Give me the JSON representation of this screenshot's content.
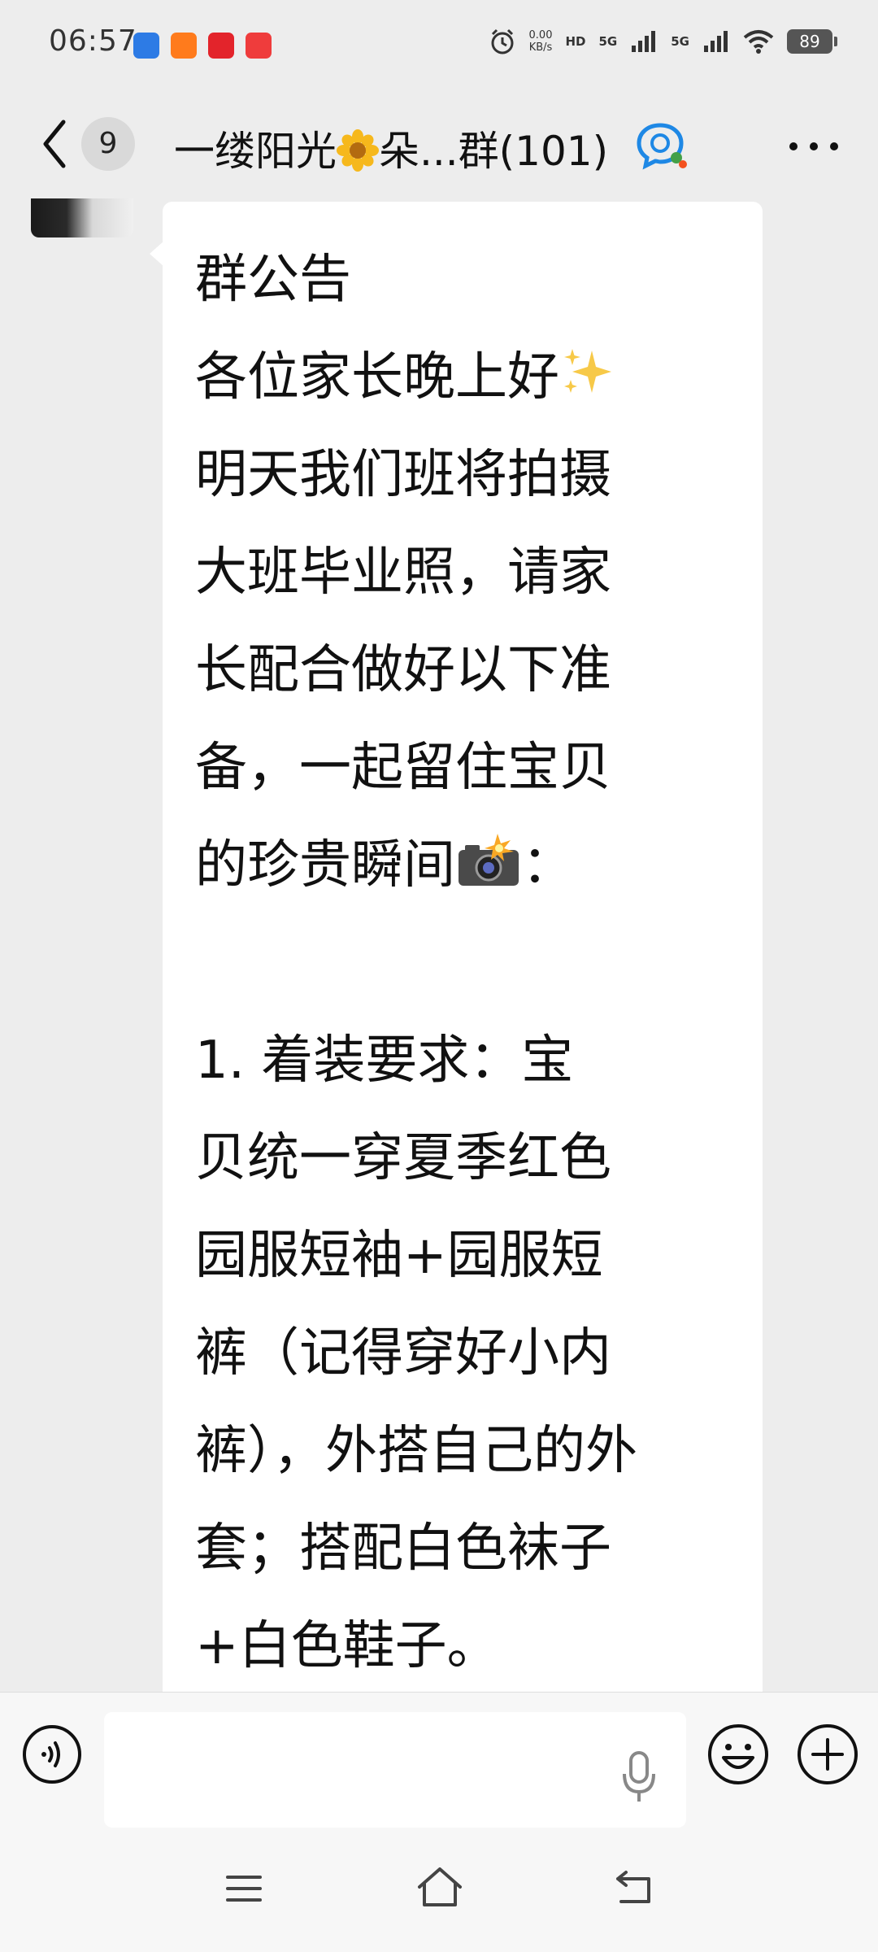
{
  "status_bar": {
    "time": "06:57",
    "net_speed_value": "0.00",
    "net_speed_unit": "KB/s",
    "hd_label": "HD",
    "sim1_label": "5G",
    "sim2_label": "5G",
    "battery": "89"
  },
  "header": {
    "unread_count": "9",
    "title_prefix": "一缕阳光",
    "title_suffix": "朵...群(101)"
  },
  "message": {
    "heading": "群公告",
    "greeting": "各位家长晚上好",
    "lines": [
      "明天我们班将拍摄",
      "大班毕业照，请家",
      "长配合做好以下准",
      "备，一起留住宝贝"
    ],
    "line_before_camera": "的珍贵瞬间",
    "line_after_camera": "：",
    "item_lines": [
      "1. 着装要求：宝",
      "贝统一穿夏季红色",
      "园服短袖+园服短",
      "裤（记得穿好小内",
      "裤），外搭自己的外",
      "套；搭配白色袜子",
      "+白色鞋子。"
    ]
  },
  "input_bar": {
    "placeholder": ""
  },
  "colors": {
    "background": "#ededed",
    "bubble": "#ffffff",
    "input_bar": "#f7f7f7"
  },
  "icons": {
    "back": "chevron-left-icon",
    "group": "group-chat-icon",
    "more": "more-dots-icon",
    "voice": "voice-icon",
    "mic": "microphone-icon",
    "emoji": "emoji-icon",
    "plus": "plus-icon"
  }
}
